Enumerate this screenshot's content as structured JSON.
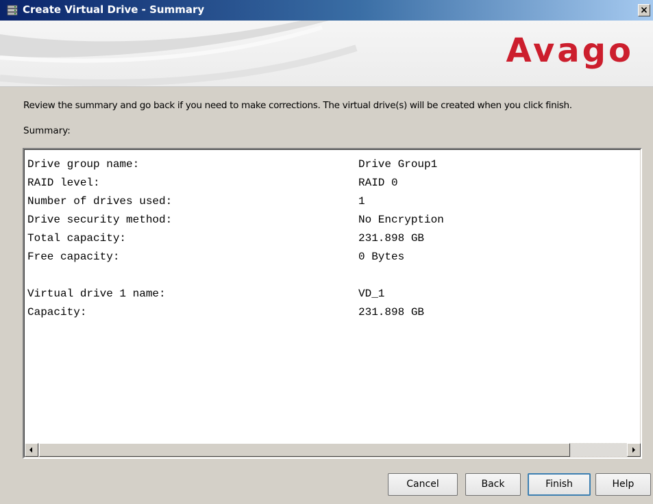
{
  "window": {
    "title": "Create Virtual Drive - Summary",
    "close_label": "×"
  },
  "banner": {
    "brand": "Avago",
    "brand_color": "#cc1e2d"
  },
  "main": {
    "instructions": "Review the summary and go back if you need to make corrections. The virtual drive(s) will be created when you click finish.",
    "summary_label": "Summary:",
    "summary_group": [
      {
        "label": "Drive group name:",
        "value": "Drive Group1"
      },
      {
        "label": "RAID level:",
        "value": "RAID 0"
      },
      {
        "label": "Number of drives used:",
        "value": "1"
      },
      {
        "label": "Drive security method:",
        "value": "No Encryption"
      },
      {
        "label": "Total capacity:",
        "value": "231.898 GB"
      },
      {
        "label": "Free capacity:",
        "value": "0 Bytes"
      }
    ],
    "summary_vd": [
      {
        "label": "Virtual drive 1 name:",
        "value": "VD_1"
      },
      {
        "label": "Capacity:",
        "value": "231.898 GB"
      }
    ]
  },
  "footer": {
    "cancel_label": "Cancel",
    "back_label": "Back",
    "finish_label": "Finish",
    "help_label": "Help"
  },
  "icons": {
    "app": "database-icon",
    "close": "close-icon",
    "scroll_left": "arrow-left-icon",
    "scroll_right": "arrow-right-icon"
  }
}
